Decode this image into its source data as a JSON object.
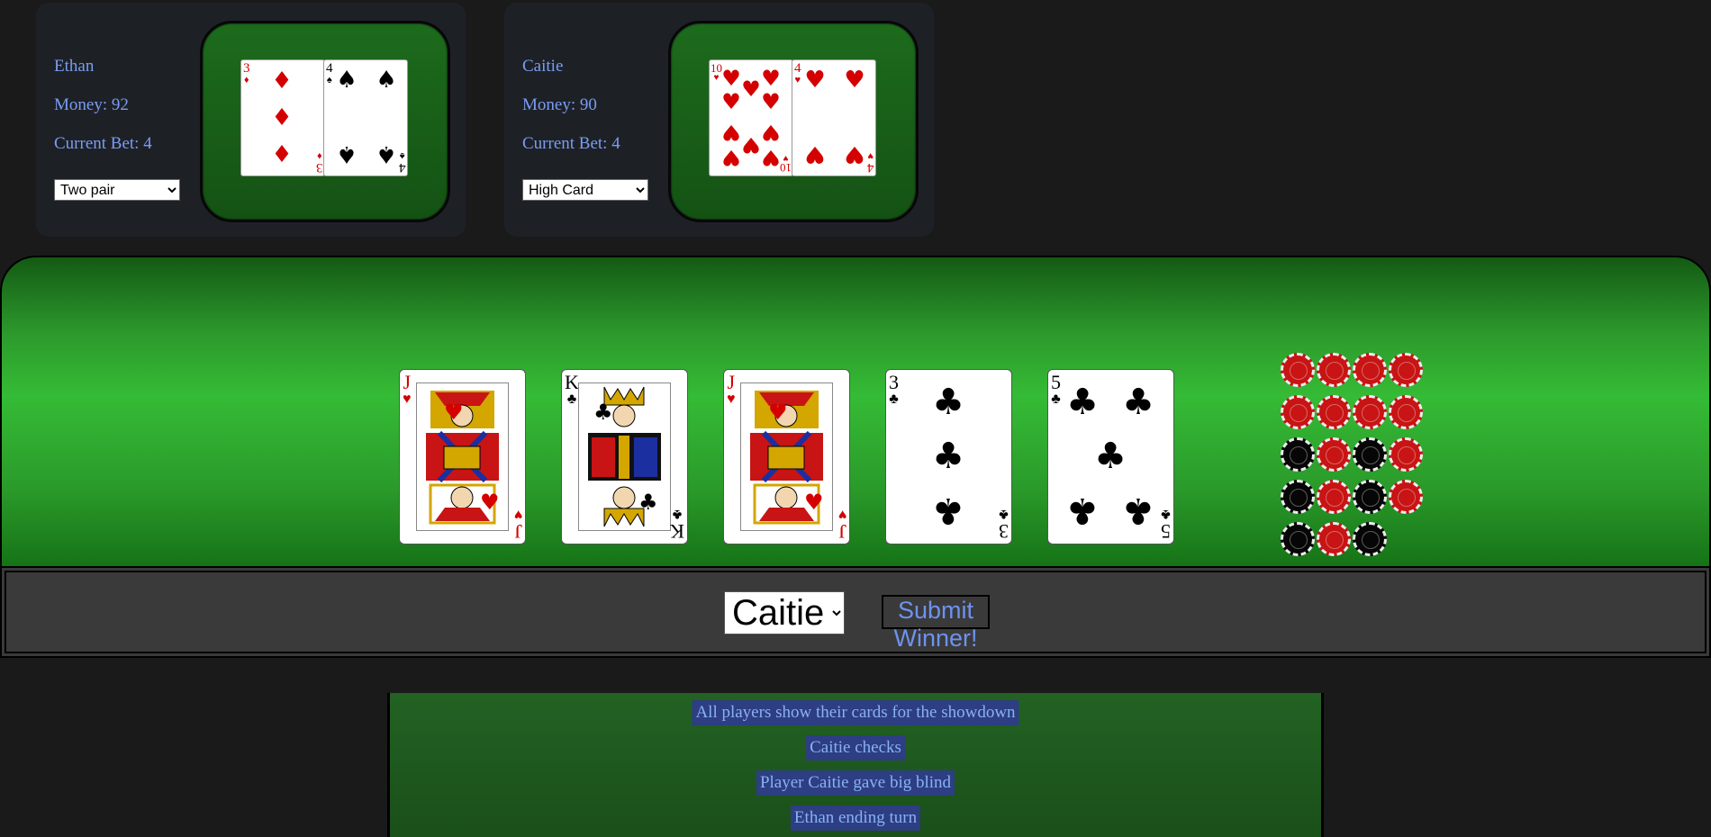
{
  "players": [
    {
      "name": "Ethan",
      "money": "Money: 92",
      "bet": "Current Bet: 4",
      "hand_rank": "Two pair",
      "cards": [
        {
          "rank": "3",
          "suit": "diamonds"
        },
        {
          "rank": "4",
          "suit": "spades"
        }
      ]
    },
    {
      "name": "Caitie",
      "money": "Money: 90",
      "bet": "Current Bet: 4",
      "hand_rank": "High Card",
      "cards": [
        {
          "rank": "10",
          "suit": "hearts"
        },
        {
          "rank": "4",
          "suit": "hearts"
        }
      ]
    }
  ],
  "community_cards": [
    {
      "rank": "J",
      "suit": "hearts",
      "face": "jack-of-hearts"
    },
    {
      "rank": "K",
      "suit": "clubs",
      "face": "king-of-clubs"
    },
    {
      "rank": "J",
      "suit": "hearts",
      "face": "jack-of-hearts"
    },
    {
      "rank": "3",
      "suit": "clubs"
    },
    {
      "rank": "5",
      "suit": "clubs"
    }
  ],
  "pot_chips": [
    [
      "red",
      "red",
      "red",
      "red"
    ],
    [
      "red",
      "red",
      "red",
      "red"
    ],
    [
      "black",
      "red",
      "black",
      "red"
    ],
    [
      "black",
      "red",
      "black",
      "red"
    ],
    [
      "black",
      "red",
      "black"
    ]
  ],
  "winner_select": {
    "value": "Caitie"
  },
  "submit_label": "Submit Winner!",
  "log": [
    "All players show their cards for the showdown",
    "Caitie checks",
    "Player Caitie gave big blind",
    "Ethan ending turn"
  ],
  "colors": {
    "chip_red": "#c81414",
    "chip_black": "#060606",
    "suit_red": "#d40000",
    "text_blue": "#7b9cf2"
  }
}
